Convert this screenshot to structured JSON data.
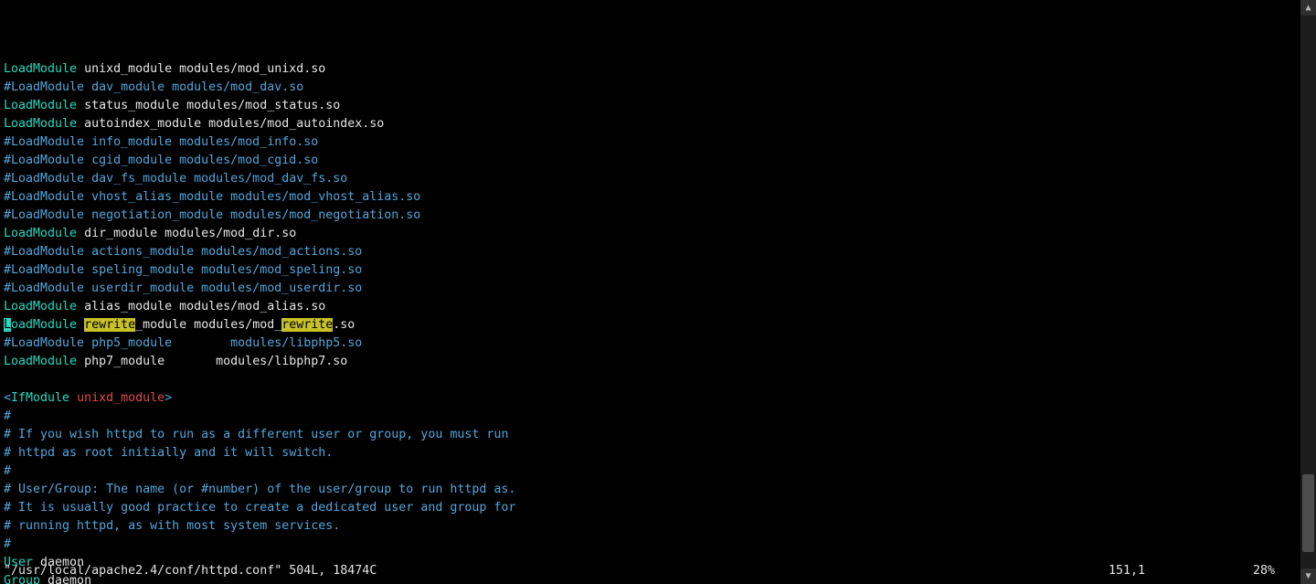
{
  "lines": [
    {
      "t": "load",
      "cursor": false,
      "a": "LoadModule",
      "b": " unixd_module modules/mod_unixd.so"
    },
    {
      "t": "comment",
      "text": "#LoadModule dav_module modules/mod_dav.so"
    },
    {
      "t": "load",
      "cursor": false,
      "a": "LoadModule",
      "b": " status_module modules/mod_status.so"
    },
    {
      "t": "load",
      "cursor": false,
      "a": "LoadModule",
      "b": " autoindex_module modules/mod_autoindex.so"
    },
    {
      "t": "comment",
      "text": "#LoadModule info_module modules/mod_info.so"
    },
    {
      "t": "comment",
      "text": "#LoadModule cgid_module modules/mod_cgid.so"
    },
    {
      "t": "comment",
      "text": "#LoadModule dav_fs_module modules/mod_dav_fs.so"
    },
    {
      "t": "comment",
      "text": "#LoadModule vhost_alias_module modules/mod_vhost_alias.so"
    },
    {
      "t": "comment",
      "text": "#LoadModule negotiation_module modules/mod_negotiation.so"
    },
    {
      "t": "load",
      "cursor": false,
      "a": "LoadModule",
      "b": " dir_module modules/mod_dir.so"
    },
    {
      "t": "comment",
      "text": "#LoadModule actions_module modules/mod_actions.so"
    },
    {
      "t": "comment",
      "text": "#LoadModule speling_module modules/mod_speling.so"
    },
    {
      "t": "comment",
      "text": "#LoadModule userdir_module modules/mod_userdir.so"
    },
    {
      "t": "load",
      "cursor": false,
      "a": "LoadModule",
      "b": " alias_module modules/mod_alias.so"
    },
    {
      "t": "rewrite"
    },
    {
      "t": "comment",
      "text": "#LoadModule php5_module        modules/libphp5.so"
    },
    {
      "t": "load",
      "cursor": false,
      "a": "LoadModule",
      "b": " php7_module       modules/libphp7.so"
    },
    {
      "t": "blank"
    },
    {
      "t": "ifmodule"
    },
    {
      "t": "comment",
      "text": "#"
    },
    {
      "t": "comment",
      "text": "# If you wish httpd to run as a different user or group, you must run"
    },
    {
      "t": "comment",
      "text": "# httpd as root initially and it will switch."
    },
    {
      "t": "comment",
      "text": "#"
    },
    {
      "t": "comment",
      "text": "# User/Group: The name (or #number) of the user/group to run httpd as."
    },
    {
      "t": "comment",
      "text": "# It is usually good practice to create a dedicated user and group for"
    },
    {
      "t": "comment",
      "text": "# running httpd, as with most system services."
    },
    {
      "t": "comment",
      "text": "#"
    },
    {
      "t": "usergroup",
      "key": "User",
      "val": " daemon"
    },
    {
      "t": "usergroup",
      "key": "Group",
      "val": " daemon"
    }
  ],
  "rewrite": {
    "cur": "L",
    "kw_rest": "oadModule",
    "sp1": " ",
    "hl1": "rewrite",
    "mid": "_module modules/mod_",
    "hl2": "rewrite",
    "tail": ".so"
  },
  "ifmodule": {
    "lt": "<",
    "tag": "IfModule",
    "sp": " ",
    "arg": "unixd_module",
    "gt": ">"
  },
  "status": {
    "file": "\"/usr/local/apache2.4/conf/httpd.conf\" 504L, 18474C",
    "pos": "151,1",
    "pct": "28%"
  },
  "scrollbar": {
    "up": "▲",
    "down": "▼",
    "thumb_top_pct": 83,
    "thumb_height_pct": 14
  }
}
